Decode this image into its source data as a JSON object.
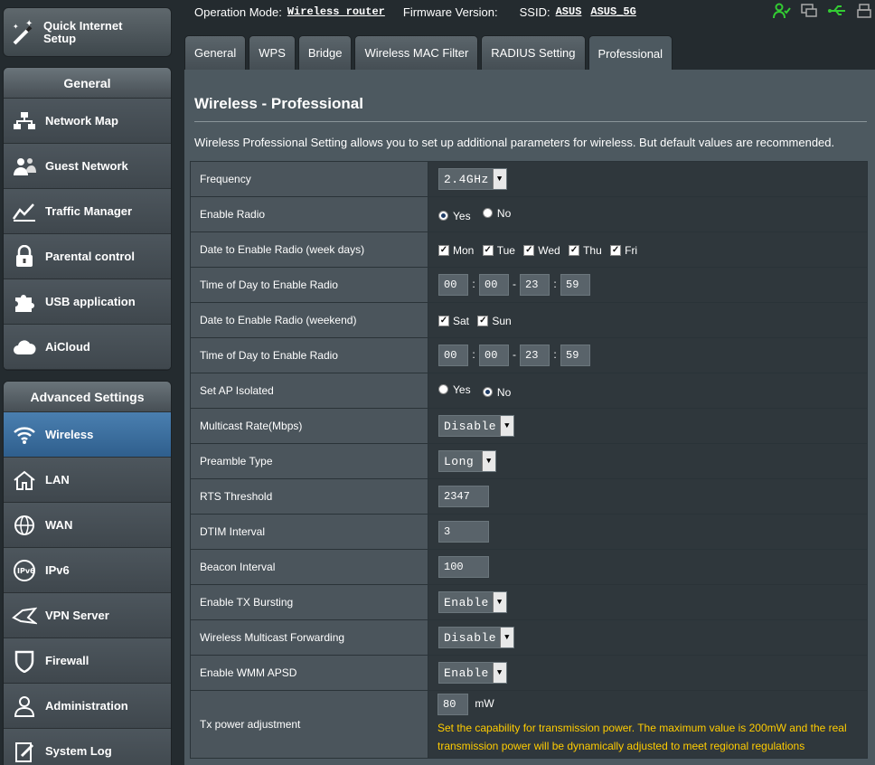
{
  "sidebar": {
    "quick_setup": "Quick Internet Setup",
    "general_header": "General",
    "general_items": [
      {
        "label": "Network Map",
        "icon": "network-map-icon"
      },
      {
        "label": "Guest Network",
        "icon": "guest-network-icon"
      },
      {
        "label": "Traffic Manager",
        "icon": "traffic-manager-icon"
      },
      {
        "label": "Parental control",
        "icon": "lock-icon"
      },
      {
        "label": "USB application",
        "icon": "puzzle-icon"
      },
      {
        "label": "AiCloud",
        "icon": "cloud-icon"
      }
    ],
    "advanced_header": "Advanced Settings",
    "advanced_items": [
      {
        "label": "Wireless",
        "icon": "wifi-icon",
        "active": true
      },
      {
        "label": "LAN",
        "icon": "home-icon"
      },
      {
        "label": "WAN",
        "icon": "globe-icon"
      },
      {
        "label": "IPv6",
        "icon": "ipv6-icon"
      },
      {
        "label": "VPN Server",
        "icon": "vpn-icon"
      },
      {
        "label": "Firewall",
        "icon": "shield-icon"
      },
      {
        "label": "Administration",
        "icon": "user-icon"
      },
      {
        "label": "System Log",
        "icon": "log-icon"
      }
    ]
  },
  "topbar": {
    "op_mode_label": "Operation Mode:",
    "op_mode_value": "Wireless router",
    "firmware_label": "Firmware Version:",
    "ssid_label": "SSID:",
    "ssid_1": "ASUS",
    "ssid_2": "ASUS_5G",
    "status_icons": [
      "users-icon",
      "display-icon",
      "usb-icon",
      "printer-icon"
    ]
  },
  "tabs": [
    "General",
    "WPS",
    "Bridge",
    "Wireless MAC Filter",
    "RADIUS Setting",
    "Professional"
  ],
  "active_tab": "Professional",
  "page": {
    "title": "Wireless - Professional",
    "description": "Wireless Professional Setting allows you to set up additional parameters for wireless. But default values are recommended."
  },
  "settings": {
    "frequency": {
      "label": "Frequency",
      "value": "2.4GHz"
    },
    "enable_radio": {
      "label": "Enable Radio",
      "yes": "Yes",
      "no": "No",
      "selected": "Yes"
    },
    "weekdays": {
      "label": "Date to Enable Radio (week days)",
      "days": [
        "Mon",
        "Tue",
        "Wed",
        "Thu",
        "Fri"
      ]
    },
    "weekday_time": {
      "label": "Time of Day to Enable Radio",
      "start_h": "00",
      "start_m": "00",
      "end_h": "23",
      "end_m": "59"
    },
    "weekend": {
      "label": "Date to Enable Radio (weekend)",
      "days": [
        "Sat",
        "Sun"
      ]
    },
    "weekend_time": {
      "label": "Time of Day to Enable Radio",
      "start_h": "00",
      "start_m": "00",
      "end_h": "23",
      "end_m": "59"
    },
    "ap_isolated": {
      "label": "Set AP Isolated",
      "yes": "Yes",
      "no": "No",
      "selected": "No"
    },
    "multicast_rate": {
      "label": "Multicast Rate(Mbps)",
      "value": "Disable"
    },
    "preamble": {
      "label": "Preamble Type",
      "value": "Long"
    },
    "rts": {
      "label": "RTS Threshold",
      "value": "2347"
    },
    "dtim": {
      "label": "DTIM Interval",
      "value": "3"
    },
    "beacon": {
      "label": "Beacon Interval",
      "value": "100"
    },
    "tx_bursting": {
      "label": "Enable TX Bursting",
      "value": "Enable"
    },
    "mcast_fwd": {
      "label": "Wireless Multicast Forwarding",
      "value": "Disable"
    },
    "wmm_apsd": {
      "label": "Enable WMM APSD",
      "value": "Enable"
    },
    "tx_power": {
      "label": "Tx power adjustment",
      "value": "80",
      "unit": "mW",
      "note": "Set the capability for transmission power. The maximum value is 200mW and the real transmission power will be dynamically adjusted to meet regional regulations"
    }
  },
  "colors": {
    "accent": "#ffcc00",
    "active_menu": "#3a6e9f",
    "status_green": "#33cc33"
  }
}
